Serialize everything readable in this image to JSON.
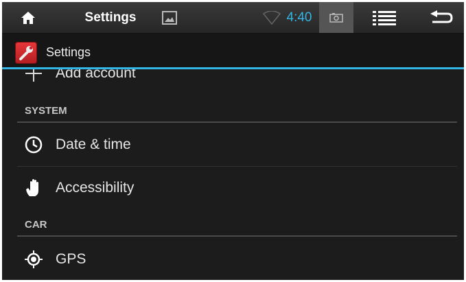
{
  "statusbar": {
    "title": "Settings",
    "time": "4:40",
    "icons": [
      "home-icon",
      "image-icon",
      "wifi-icon",
      "screenshot-icon",
      "menu-icon",
      "back-icon"
    ]
  },
  "actionbar": {
    "title": "Settings",
    "accent_color": "#33b5e5"
  },
  "list": {
    "add_account": "Add account",
    "sections": [
      {
        "header": "SYSTEM",
        "items": [
          {
            "label": "Date & time",
            "icon": "clock-icon"
          },
          {
            "label": "Accessibility",
            "icon": "hand-icon"
          }
        ]
      },
      {
        "header": "CAR",
        "items": [
          {
            "label": "GPS",
            "icon": "gps-icon"
          }
        ]
      }
    ]
  }
}
